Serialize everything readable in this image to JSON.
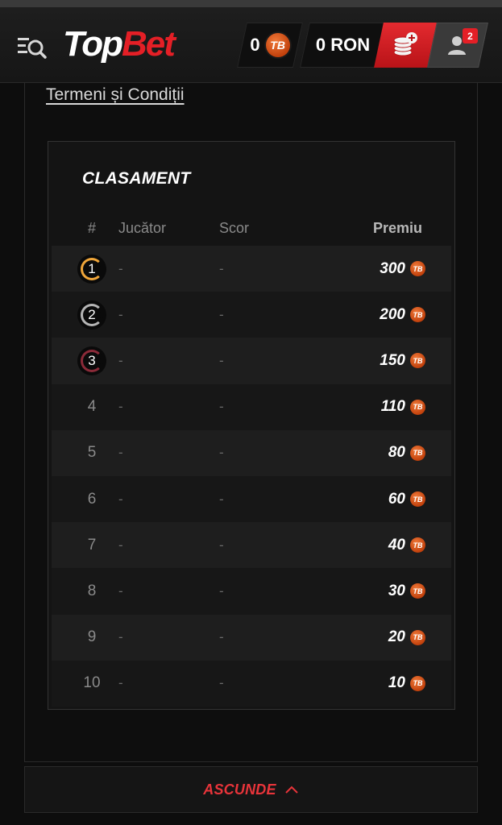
{
  "header": {
    "logo_top": "Top",
    "logo_bet": "Bet",
    "coins_value": "0",
    "coin_symbol": "TB",
    "balance": "0 RON",
    "notifications_count": "2"
  },
  "terms_link": "Termeni și Condiții",
  "leaderboard": {
    "title": "CLASAMENT",
    "columns": {
      "rank": "#",
      "player": "Jucător",
      "score": "Scor",
      "prize": "Premiu"
    },
    "rows": [
      {
        "rank": "1",
        "player": "-",
        "score": "-",
        "prize": "300",
        "medal": "gold"
      },
      {
        "rank": "2",
        "player": "-",
        "score": "-",
        "prize": "200",
        "medal": "silver"
      },
      {
        "rank": "3",
        "player": "-",
        "score": "-",
        "prize": "150",
        "medal": "bronze"
      },
      {
        "rank": "4",
        "player": "-",
        "score": "-",
        "prize": "110"
      },
      {
        "rank": "5",
        "player": "-",
        "score": "-",
        "prize": "80"
      },
      {
        "rank": "6",
        "player": "-",
        "score": "-",
        "prize": "60"
      },
      {
        "rank": "7",
        "player": "-",
        "score": "-",
        "prize": "40"
      },
      {
        "rank": "8",
        "player": "-",
        "score": "-",
        "prize": "30"
      },
      {
        "rank": "9",
        "player": "-",
        "score": "-",
        "prize": "20"
      },
      {
        "rank": "10",
        "player": "-",
        "score": "-",
        "prize": "10"
      }
    ]
  },
  "hide_button": "ASCUNDE",
  "colors": {
    "brand_red": "#e41f26",
    "coin_orange": "#d9531e",
    "gold": "#f0a63a",
    "silver": "#b5b5b5",
    "bronze": "#8a2a38"
  }
}
